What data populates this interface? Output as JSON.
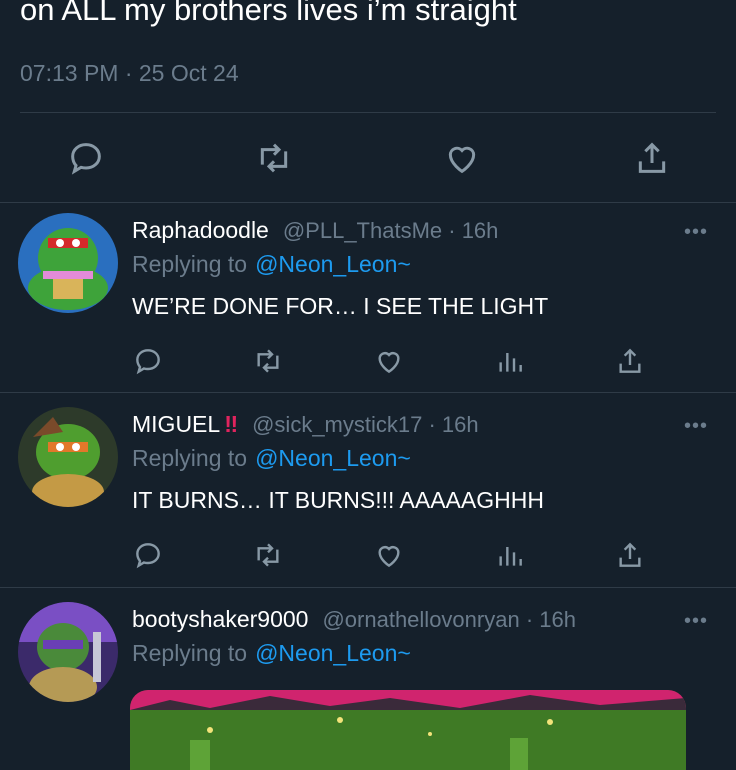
{
  "tweet": {
    "text": "on ALL my brothers lives i’m straight",
    "timestamp": "07:13 PM · 25 Oct 24"
  },
  "replies": [
    {
      "name": "Raphadoodle",
      "badge": "",
      "handle": "@PLL_ThatsMe",
      "time": " · 16h",
      "replying_label": "Replying to",
      "mention": "@Neon_Leon~",
      "text": "WE’RE DONE FOR… I SEE THE LIGHT",
      "more": "•••"
    },
    {
      "name": "MIGUEL",
      "badge": "‼",
      "handle": "@sick_mystick17",
      "time": " · 16h",
      "replying_label": "Replying to",
      "mention": "@Neon_Leon~",
      "text": "IT BURNS… IT BURNS!!! AAAAAGHHH",
      "more": "•••"
    },
    {
      "name": "bootyshaker9000",
      "badge": "",
      "handle": "@ornathellovonryan",
      "time": " · 16h",
      "replying_label": "Replying to",
      "mention": "@Neon_Leon~",
      "text": "",
      "more": "•••"
    }
  ],
  "icons": {
    "reply": "reply-icon",
    "retweet": "retweet-icon",
    "like": "like-icon",
    "analytics": "analytics-icon",
    "share": "share-icon"
  },
  "colors": {
    "background": "#15202b",
    "muted": "#6b7c8c",
    "link": "#1d9bf0",
    "divider": "#2f3b47"
  }
}
